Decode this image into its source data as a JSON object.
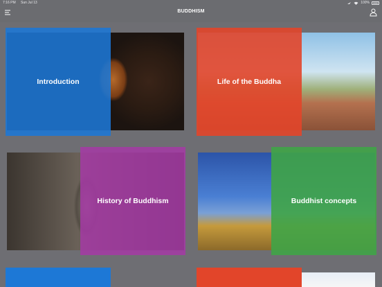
{
  "status_bar": {
    "time": "7:16 PM",
    "date": "Sun Jul 13",
    "battery": "100%"
  },
  "nav": {
    "title": "BUDDHISM",
    "menu_icon": "hamburger-menu-icon",
    "user_icon": "user-icon"
  },
  "tiles": [
    {
      "label": "Introduction",
      "overlay_color": "#1d78d6"
    },
    {
      "label": "Life of the Buddha",
      "overlay_color": "#e2452a"
    },
    {
      "label": "History of Buddhism",
      "overlay_color": "#a63aa6"
    },
    {
      "label": "Buddhist concepts",
      "overlay_color": "#3fa447"
    },
    {
      "label": "",
      "overlay_color": "#1d78d6"
    },
    {
      "label": "",
      "overlay_color": "#e2452a"
    }
  ],
  "colors": {
    "background": "#6e6e73",
    "nav_bar": "#6b6c70"
  }
}
